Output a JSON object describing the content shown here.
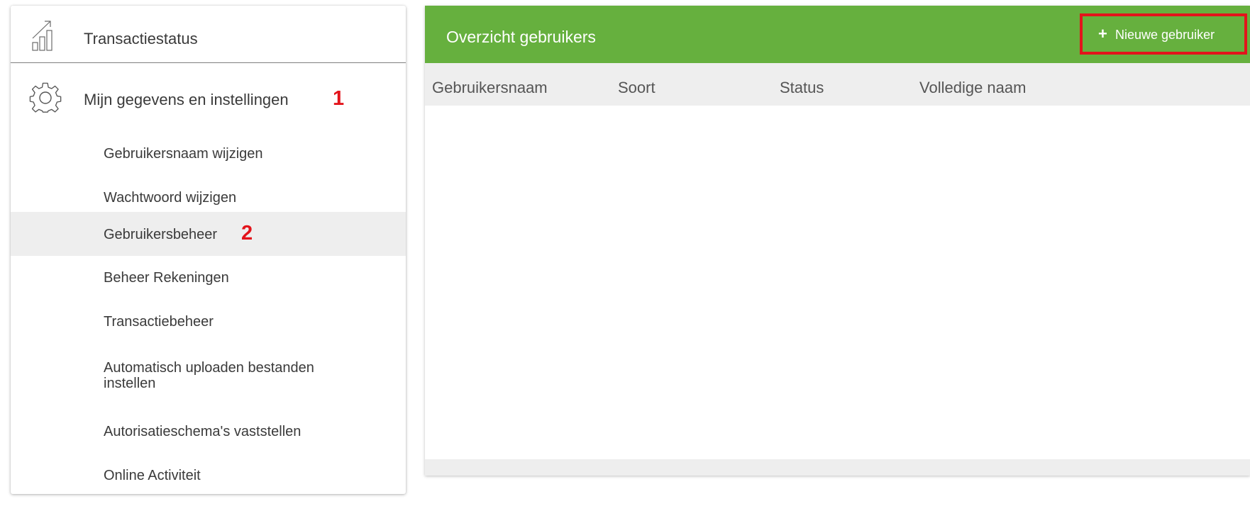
{
  "sidebar": {
    "transaction_status": {
      "label": "Transactiestatus",
      "icon": "chart-icon"
    },
    "settings": {
      "label": "Mijn gegevens en instellingen",
      "marker": "1",
      "icon": "gear-icon"
    },
    "items": [
      {
        "label": "Gebruikersnaam wijzigen",
        "marker": ""
      },
      {
        "label": "Wachtwoord wijzigen",
        "marker": ""
      },
      {
        "label": "Gebruikersbeheer",
        "marker": "2",
        "active": true
      },
      {
        "label": "Beheer Rekeningen",
        "marker": ""
      },
      {
        "label": "Transactiebeheer",
        "marker": ""
      },
      {
        "label": "Automatisch uploaden bestanden",
        "label_line2": "instellen",
        "marker": ""
      },
      {
        "label": "Autorisatieschema's vaststellen",
        "marker": ""
      },
      {
        "label": "Online Activiteit",
        "marker": ""
      }
    ]
  },
  "main": {
    "title": "Overzicht gebruikers",
    "new_user_button": {
      "icon": "+",
      "label": "Nieuwe gebruiker"
    },
    "columns": [
      "Gebruikersnaam",
      "Soort",
      "Status",
      "Volledige naam"
    ],
    "rows": []
  },
  "colors": {
    "header_green": "#66b03e",
    "marker_red": "#e3141b",
    "active_row": "#eeeeee",
    "table_header": "#eeeeee"
  }
}
